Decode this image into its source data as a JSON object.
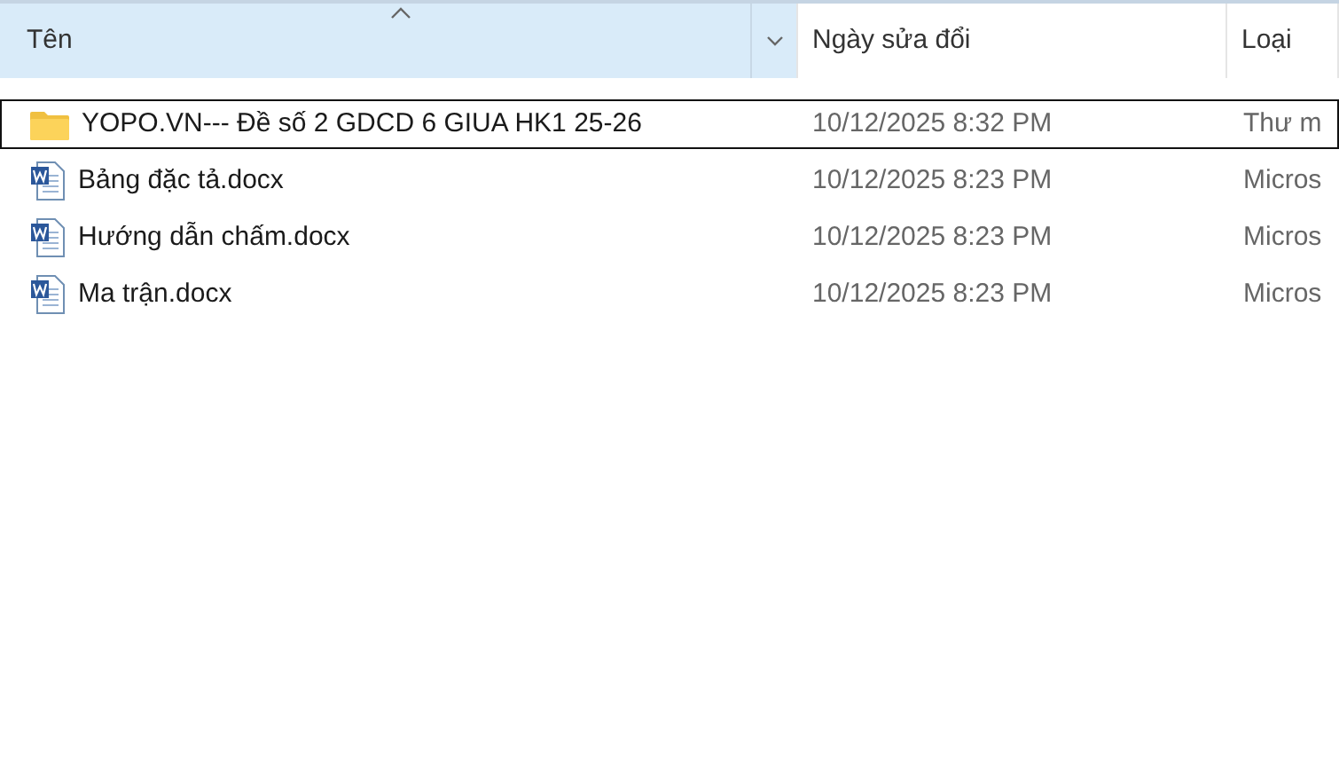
{
  "columns": [
    {
      "label": "Tên",
      "sorted": true,
      "dropdown": true
    },
    {
      "label": "Ngày sửa đổi",
      "sorted": false,
      "dropdown": false
    },
    {
      "label": "Loại",
      "sorted": false,
      "dropdown": false
    }
  ],
  "files": [
    {
      "kind": "folder",
      "name": "YOPO.VN--- Đề số 2 GDCD 6 GIUA HK1 25-26",
      "modified": "10/12/2025 8:32 PM",
      "type": "Thư m",
      "focused": true
    },
    {
      "kind": "docx",
      "name": "Bảng đặc tả.docx",
      "modified": "10/12/2025 8:23 PM",
      "type": "Micros",
      "focused": false
    },
    {
      "kind": "docx",
      "name": "Hướng dẫn chấm.docx",
      "modified": "10/12/2025 8:23 PM",
      "type": "Micros",
      "focused": false
    },
    {
      "kind": "docx",
      "name": "Ma trận.docx",
      "modified": "10/12/2025 8:23 PM",
      "type": "Micros",
      "focused": false
    }
  ]
}
